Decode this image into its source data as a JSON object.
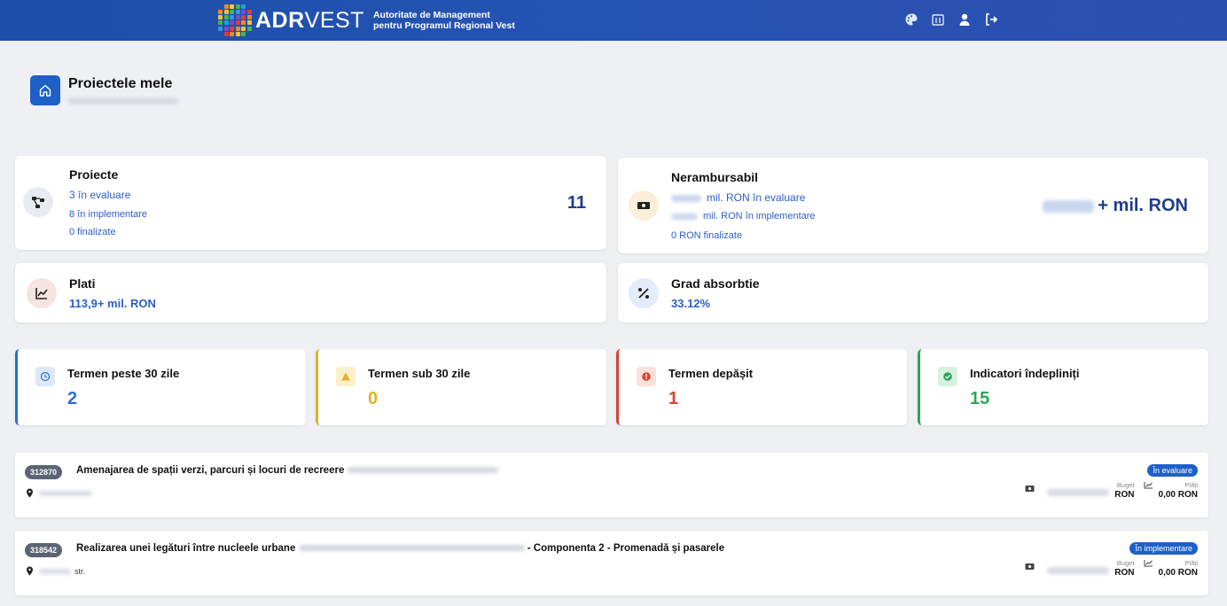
{
  "header": {
    "brand_bold": "ADR",
    "brand_light": "VEST",
    "brand_sub_line1": "Autoritate de Management",
    "brand_sub_line2": "pentru Programul Regional Vest"
  },
  "page": {
    "title": "Proiectele mele"
  },
  "cards": {
    "proiecte": {
      "title": "Proiecte",
      "line1": "3 în evaluare",
      "line2": "8 în implementare",
      "line3": "0 finalizate",
      "total": "11"
    },
    "nerambursabil": {
      "title": "Nerambursabil",
      "line1": "mil. RON în evaluare",
      "line2": "mil. RON în implementare",
      "line3": "0 RON finalizate",
      "total": "+ mil. RON"
    },
    "plati": {
      "title": "Plati",
      "value": "113,9+ mil. RON"
    },
    "grad": {
      "title": "Grad absorbtie",
      "value": "33.12%"
    }
  },
  "deadlines": [
    {
      "label": "Termen peste 30 zile",
      "value": "2",
      "color": "#2d6fd0"
    },
    {
      "label": "Termen sub 30 zile",
      "value": "0",
      "color": "#e0b12f"
    },
    {
      "label": "Termen depășit",
      "value": "1",
      "color": "#d7452e"
    },
    {
      "label": "Indicatori îndepliniți",
      "value": "15",
      "color": "#2fa55b"
    }
  ],
  "projects": [
    {
      "id": "312870",
      "title": "Amenajarea de spații verzi, parcuri și locuri de recreere",
      "title_suffix": "",
      "status": "În evaluare",
      "location": "",
      "buget_label": "Buget",
      "buget_value": "RON",
      "plati_label": "Plăți",
      "plati_value": "0,00 RON"
    },
    {
      "id": "318542",
      "title": "Realizarea unei legături între nucleele urbane",
      "title_suffix": "- Componenta 2 - Promenadă și pasarele",
      "status": "În implementare",
      "location": "str.",
      "buget_label": "Buget",
      "buget_value": "RON",
      "plati_label": "Plăți",
      "plati_value": "0,00 RON"
    }
  ],
  "colors": {
    "header": "#2553b4",
    "accent": "#1f5fc8",
    "link": "#2d5fc4"
  }
}
